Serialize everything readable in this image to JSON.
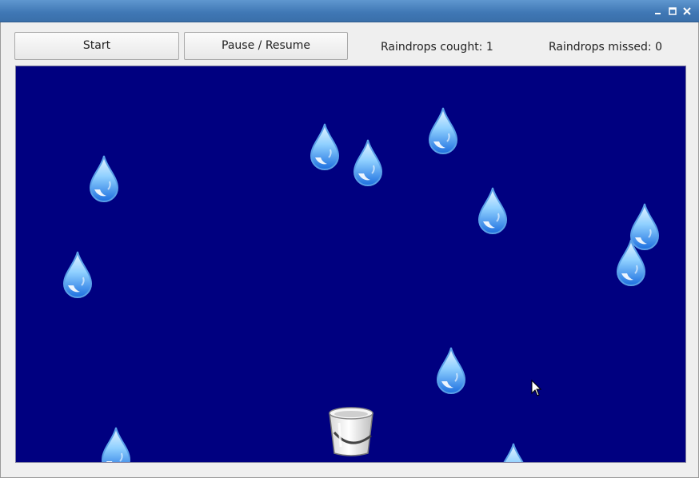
{
  "window": {
    "controls": {
      "minimize_icon": "minimize-icon",
      "maximize_icon": "maximize-icon",
      "close_icon": "close-icon"
    }
  },
  "toolbar": {
    "start_label": "Start",
    "pause_label": "Pause / Resume",
    "caught_text": "Raindrops cought: 1",
    "missed_text": "Raindrops missed: 0"
  },
  "game": {
    "background_color": "#000080",
    "drop_icon": "raindrop-icon",
    "bucket_icon": "bucket-icon",
    "raindrop_count": 12
  }
}
